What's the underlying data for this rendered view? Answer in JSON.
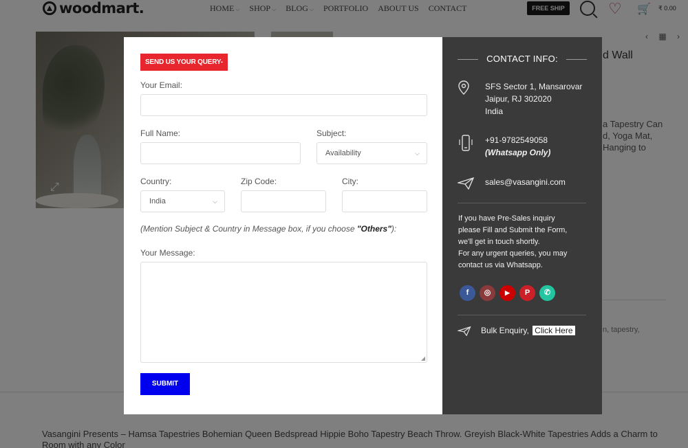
{
  "site": {
    "logo_text": "woodmart.",
    "nav": [
      "HOME",
      "SHOP",
      "BLOG",
      "PORTFOLIO",
      "ABOUT US",
      "CONTACT"
    ],
    "free_ship": "FREE SHIP",
    "cart_price": "₹ 0.00",
    "title_fragment": "d Wall",
    "desc_fragment": [
      "a Tapestry Can",
      "d, Yoga Mat,",
      "Hanging to"
    ],
    "tags_fragment": "n, tapestry,",
    "bottom_text": "Vasangini Presents – Hamsa Tapestries Bohemian Queen Bedspread Hippie Boho Tapestry Beach Throw. Greyish Black-White Tapestries Adds a Charm to Room with any Color"
  },
  "form": {
    "badge": "SEND US YOUR QUERY-",
    "email_label": "Your Email:",
    "fullname_label": "Full Name:",
    "subject_label": "Subject:",
    "subject_value": "Availability",
    "country_label": "Country:",
    "country_value": "India",
    "zip_label": "Zip Code:",
    "city_label": "City:",
    "note_prefix": "(Mention Subject & Country in Message box, if you choose ",
    "note_emph": "\"Others\"",
    "note_suffix": "):",
    "message_label": "Your Message:",
    "submit_label": "SUBMIT"
  },
  "contact": {
    "heading": "CONTACT INFO:",
    "address": [
      "SFS Sector 1, Mansarovar",
      "Jaipur, RJ 302020",
      "India"
    ],
    "phone": "+91-9782549058",
    "phone_note": "(Whatsapp Only)",
    "email": "sales@vasangini.com",
    "paragraph": [
      "If you have Pre-Sales inquiry",
      "please Fill and Submit the Form,",
      "we'll get in touch shortly.",
      "For any urgent queries, you may",
      "contact us via Whatsapp."
    ],
    "socials": [
      {
        "icon": "facebook-icon",
        "glyph": "f",
        "color": "#3b5998"
      },
      {
        "icon": "instagram-icon",
        "glyph": "◎",
        "color": "#8a3a3a"
      },
      {
        "icon": "youtube-icon",
        "glyph": "▶",
        "color": "#cc0000"
      },
      {
        "icon": "pinterest-icon",
        "glyph": "P",
        "color": "#cb2027"
      },
      {
        "icon": "whatsapp-icon",
        "glyph": "✆",
        "color": "#25c4a0"
      }
    ],
    "bulk_label": "Bulk Enquiry,",
    "bulk_link": "Click Here"
  }
}
